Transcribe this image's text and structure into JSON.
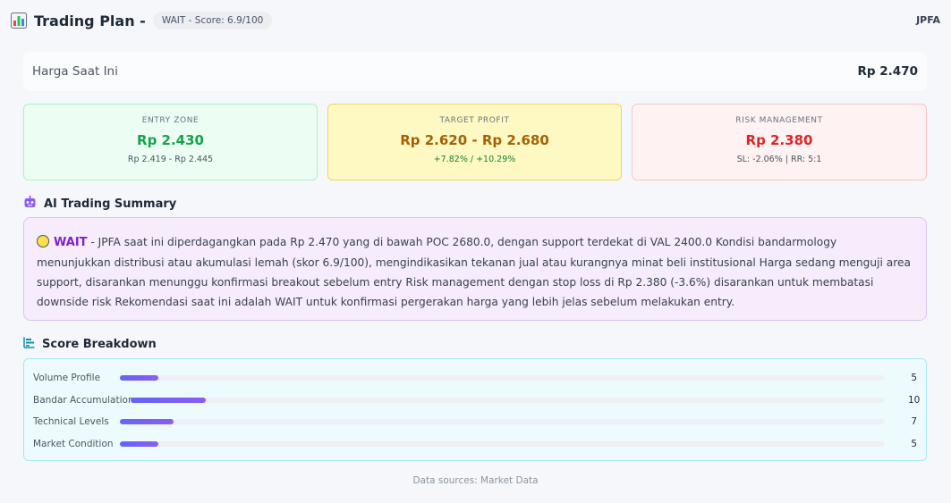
{
  "header": {
    "title": "Trading Plan -",
    "status": "WAIT - Score: 6.9/100",
    "ticker": "JPFA",
    "icon": "bar-chart-icon"
  },
  "current_price": {
    "label": "Harga Saat Ini",
    "value": "Rp 2.470"
  },
  "zones": {
    "entry": {
      "heading": "ENTRY ZONE",
      "main": "Rp 2.430",
      "sub": "Rp 2.419 - Rp 2.445",
      "color": "#16a34a"
    },
    "target": {
      "heading": "TARGET PROFIT",
      "main": "Rp 2.620 - Rp 2.680",
      "sub": "+7.82% / +10.29%",
      "color": "#a16207"
    },
    "risk": {
      "heading": "RISK MANAGEMENT",
      "main": "Rp 2.380",
      "sub": "SL: -2.06% | RR: 5:1",
      "color": "#dc2626"
    }
  },
  "summary": {
    "title": "AI Trading Summary",
    "icon": "robot-icon",
    "label": "WAIT",
    "text": " - JPFA saat ini diperdagangkan pada Rp 2.470 yang di bawah POC 2680.0, dengan support terdekat di VAL 2400.0 Kondisi bandarmology menunjukkan distribusi atau akumulasi lemah (skor 6.9/100), mengindikasikan tekanan jual atau kurangnya minat beli institusional Harga sedang menguji area support, disarankan menunggu konfirmasi breakout sebelum entry Risk management dengan stop loss di Rp 2.380 (-3.6%) disarankan untuk membatasi downside risk Rekomendasi saat ini adalah WAIT untuk konfirmasi pergerakan harga yang lebih jelas sebelum melakukan entry."
  },
  "scores": {
    "title": "Score Breakdown",
    "icon": "bar-list-icon",
    "max": 100,
    "items": [
      {
        "label": "Volume Profile",
        "value": 5
      },
      {
        "label": "Bandar Accumulation",
        "value": 10
      },
      {
        "label": "Technical Levels",
        "value": 7
      },
      {
        "label": "Market Condition",
        "value": 5
      }
    ]
  },
  "footer": "Data sources: Market Data"
}
